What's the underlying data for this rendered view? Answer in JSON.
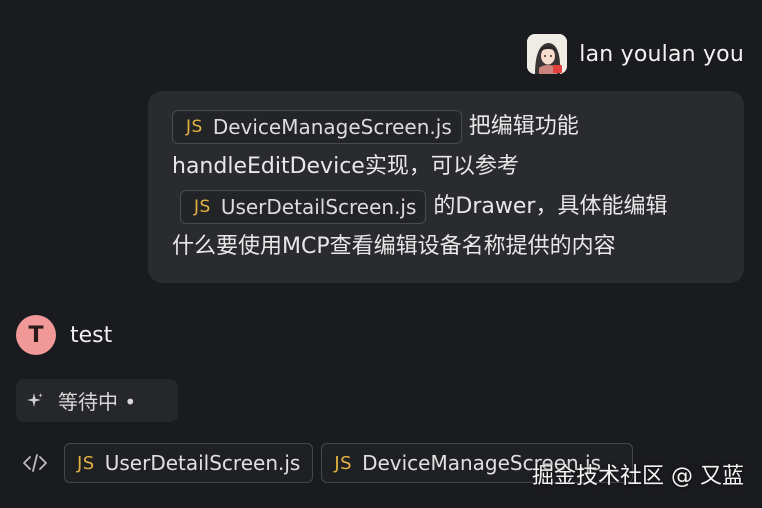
{
  "user": {
    "name": "lan youlan you"
  },
  "message": {
    "file1": "DeviceManageScreen.js",
    "text1": "把编辑功能",
    "text2": "handleEditDevice实现，可以参考",
    "file2": "UserDetailScreen.js",
    "text3": "的Drawer，具体能编辑",
    "text4": "什么要使用MCP查看编辑设备名称提供的内容"
  },
  "assistant": {
    "avatar_letter": "T",
    "name": "test",
    "status": "等待中 •"
  },
  "files": [
    {
      "label": "UserDetailScreen.js",
      "badge": "JS"
    },
    {
      "label": "DeviceManageScreen.js",
      "badge": "JS"
    }
  ],
  "badge": "JS",
  "watermark": "掘金技术社区 @ 又蓝",
  "colors": {
    "background": "#1a1b1e",
    "bubble": "#2a2b2e",
    "js_badge": "#e3b341",
    "assistant_avatar": "#f19999"
  }
}
